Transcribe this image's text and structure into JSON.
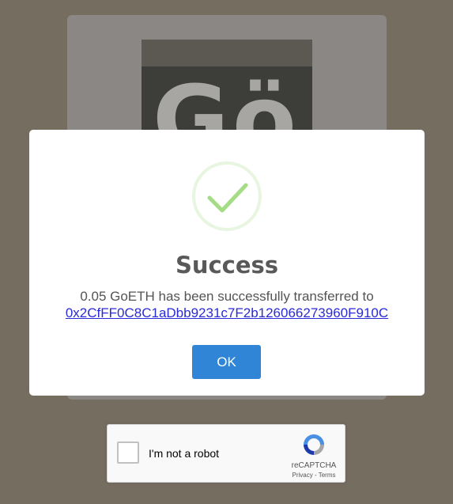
{
  "background_page": {
    "logo_text": "Gö"
  },
  "recaptcha": {
    "label": "I'm not a robot",
    "brand": "reCAPTCHA",
    "links": "Privacy - Terms"
  },
  "modal": {
    "title": "Success",
    "message": "0.05 GoETH has been successfully transferred to",
    "address": "0x2CfFF0C8C1aDbb9231c7F2b126066273960F910C",
    "ok_label": "OK",
    "icon": "checkmark-icon"
  },
  "colors": {
    "accent": "#3085d6",
    "success": "#a5dc86",
    "overlay": "#766d61"
  }
}
